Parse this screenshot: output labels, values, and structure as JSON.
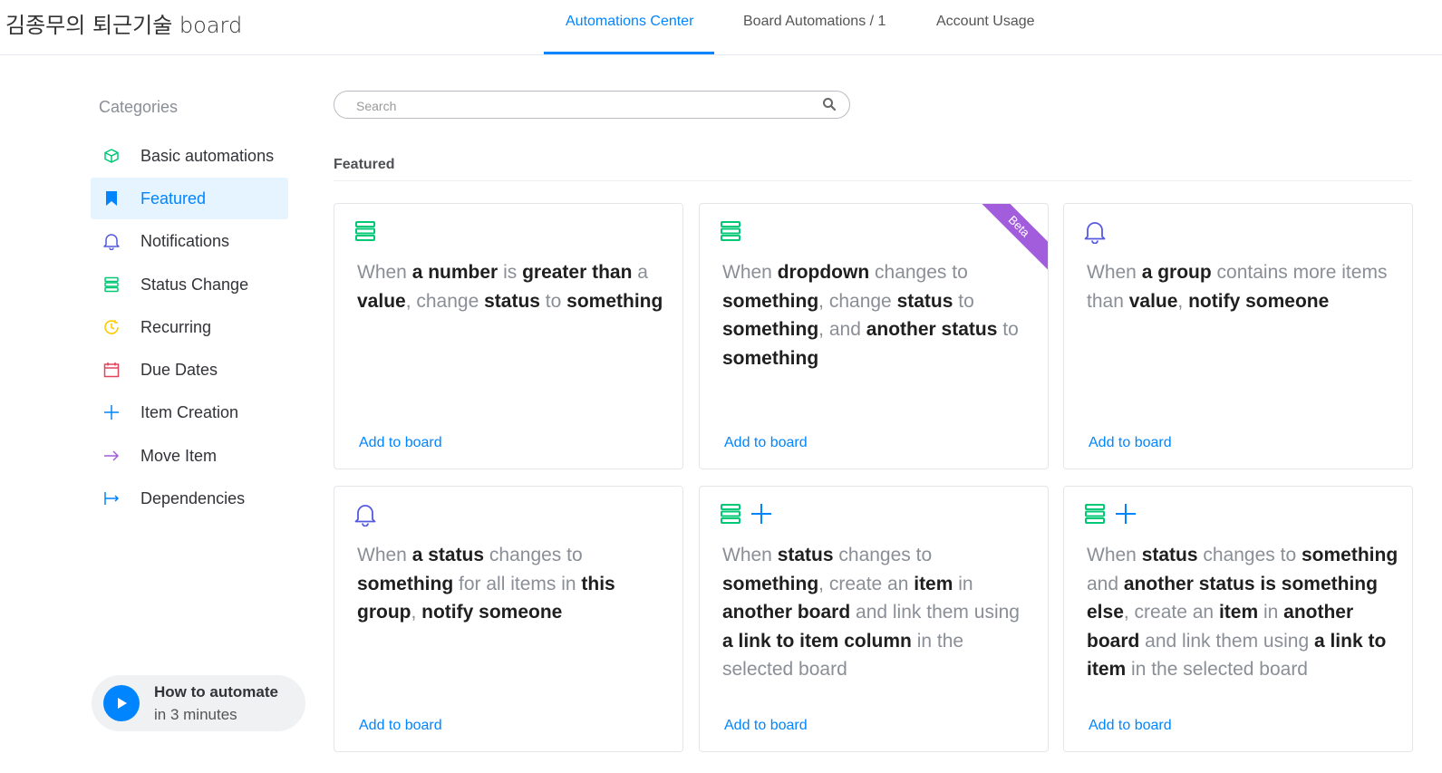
{
  "header": {
    "board_title": "김종무의 퇴근기술 board",
    "tabs": [
      {
        "label": "Automations Center",
        "active": true
      },
      {
        "label": "Board Automations / 1",
        "active": false
      },
      {
        "label": "Account Usage",
        "active": false
      }
    ]
  },
  "sidebar": {
    "title": "Categories",
    "items": [
      {
        "label": "Basic automations",
        "icon": "cube-icon",
        "color": "#00c875"
      },
      {
        "label": "Featured",
        "icon": "bookmark-icon",
        "color": "#0085ff",
        "active": true
      },
      {
        "label": "Notifications",
        "icon": "bell-icon",
        "color": "#5559df"
      },
      {
        "label": "Status Change",
        "icon": "status-icon",
        "color": "#00c875"
      },
      {
        "label": "Recurring",
        "icon": "clock-icon",
        "color": "#ffcb00"
      },
      {
        "label": "Due Dates",
        "icon": "calendar-icon",
        "color": "#e2445c"
      },
      {
        "label": "Item Creation",
        "icon": "plus-icon",
        "color": "#0085ff"
      },
      {
        "label": "Move Item",
        "icon": "arrow-right-icon",
        "color": "#a25ddc"
      },
      {
        "label": "Dependencies",
        "icon": "dependency-icon",
        "color": "#0085ff"
      }
    ],
    "howto": {
      "line1": "How to automate",
      "line2": "in 3 minutes"
    }
  },
  "search": {
    "placeholder": "Search",
    "value": ""
  },
  "section_title": "Featured",
  "colors": {
    "accent": "#0085ff",
    "status_green": "#00c875",
    "notify_purple": "#5559df",
    "beta_purple": "#a25ddc"
  },
  "cards": [
    {
      "icons": [
        "status-icon"
      ],
      "beta": false,
      "add_label": "Add to board",
      "parts": [
        [
          "When ",
          0
        ],
        [
          "a number",
          1
        ],
        [
          " is ",
          0
        ],
        [
          "greater than",
          1
        ],
        [
          " a ",
          0
        ],
        [
          "value",
          1
        ],
        [
          ", change ",
          0
        ],
        [
          "status",
          1
        ],
        [
          " to ",
          0
        ],
        [
          "something",
          1
        ]
      ]
    },
    {
      "icons": [
        "status-icon"
      ],
      "beta": true,
      "beta_label": "Beta",
      "add_label": "Add to board",
      "parts": [
        [
          "When ",
          0
        ],
        [
          "dropdown",
          1
        ],
        [
          " changes to ",
          0
        ],
        [
          "something",
          1
        ],
        [
          ", change ",
          0
        ],
        [
          "status",
          1
        ],
        [
          " to ",
          0
        ],
        [
          "something",
          1
        ],
        [
          ", and ",
          0
        ],
        [
          "another status",
          1
        ],
        [
          " to ",
          0
        ],
        [
          "something",
          1
        ]
      ]
    },
    {
      "icons": [
        "bell-icon"
      ],
      "beta": false,
      "add_label": "Add to board",
      "parts": [
        [
          "When ",
          0
        ],
        [
          "a group",
          1
        ],
        [
          " contains more items than ",
          0
        ],
        [
          "value",
          1
        ],
        [
          ", ",
          0
        ],
        [
          "notify someone",
          1
        ]
      ]
    },
    {
      "icons": [
        "bell-icon"
      ],
      "beta": false,
      "add_label": "Add to board",
      "parts": [
        [
          "When ",
          0
        ],
        [
          "a status",
          1
        ],
        [
          " changes to ",
          0
        ],
        [
          "something",
          1
        ],
        [
          " for all items in ",
          0
        ],
        [
          "this group",
          1
        ],
        [
          ", ",
          0
        ],
        [
          "notify someone",
          1
        ]
      ]
    },
    {
      "icons": [
        "status-icon",
        "plus-icon"
      ],
      "beta": false,
      "add_label": "Add to board",
      "parts": [
        [
          "When ",
          0
        ],
        [
          "status",
          1
        ],
        [
          " changes to ",
          0
        ],
        [
          "something",
          1
        ],
        [
          ", create an ",
          0
        ],
        [
          "item",
          1
        ],
        [
          " in ",
          0
        ],
        [
          "another board",
          1
        ],
        [
          " and link them using ",
          0
        ],
        [
          "a link to item column",
          1
        ],
        [
          " in the selected board",
          0
        ]
      ]
    },
    {
      "icons": [
        "status-icon",
        "plus-icon"
      ],
      "beta": false,
      "add_label": "Add to board",
      "parts": [
        [
          "When ",
          0
        ],
        [
          "status",
          1
        ],
        [
          " changes to ",
          0
        ],
        [
          "something",
          1
        ],
        [
          " and ",
          0
        ],
        [
          "another status",
          1
        ],
        [
          " is ",
          1
        ],
        [
          "something else",
          1
        ],
        [
          ", create an ",
          0
        ],
        [
          "item",
          1
        ],
        [
          " in ",
          0
        ],
        [
          "another board",
          1
        ],
        [
          " and link them using ",
          0
        ],
        [
          "a link to item",
          1
        ],
        [
          " in the selected board",
          0
        ]
      ]
    }
  ]
}
